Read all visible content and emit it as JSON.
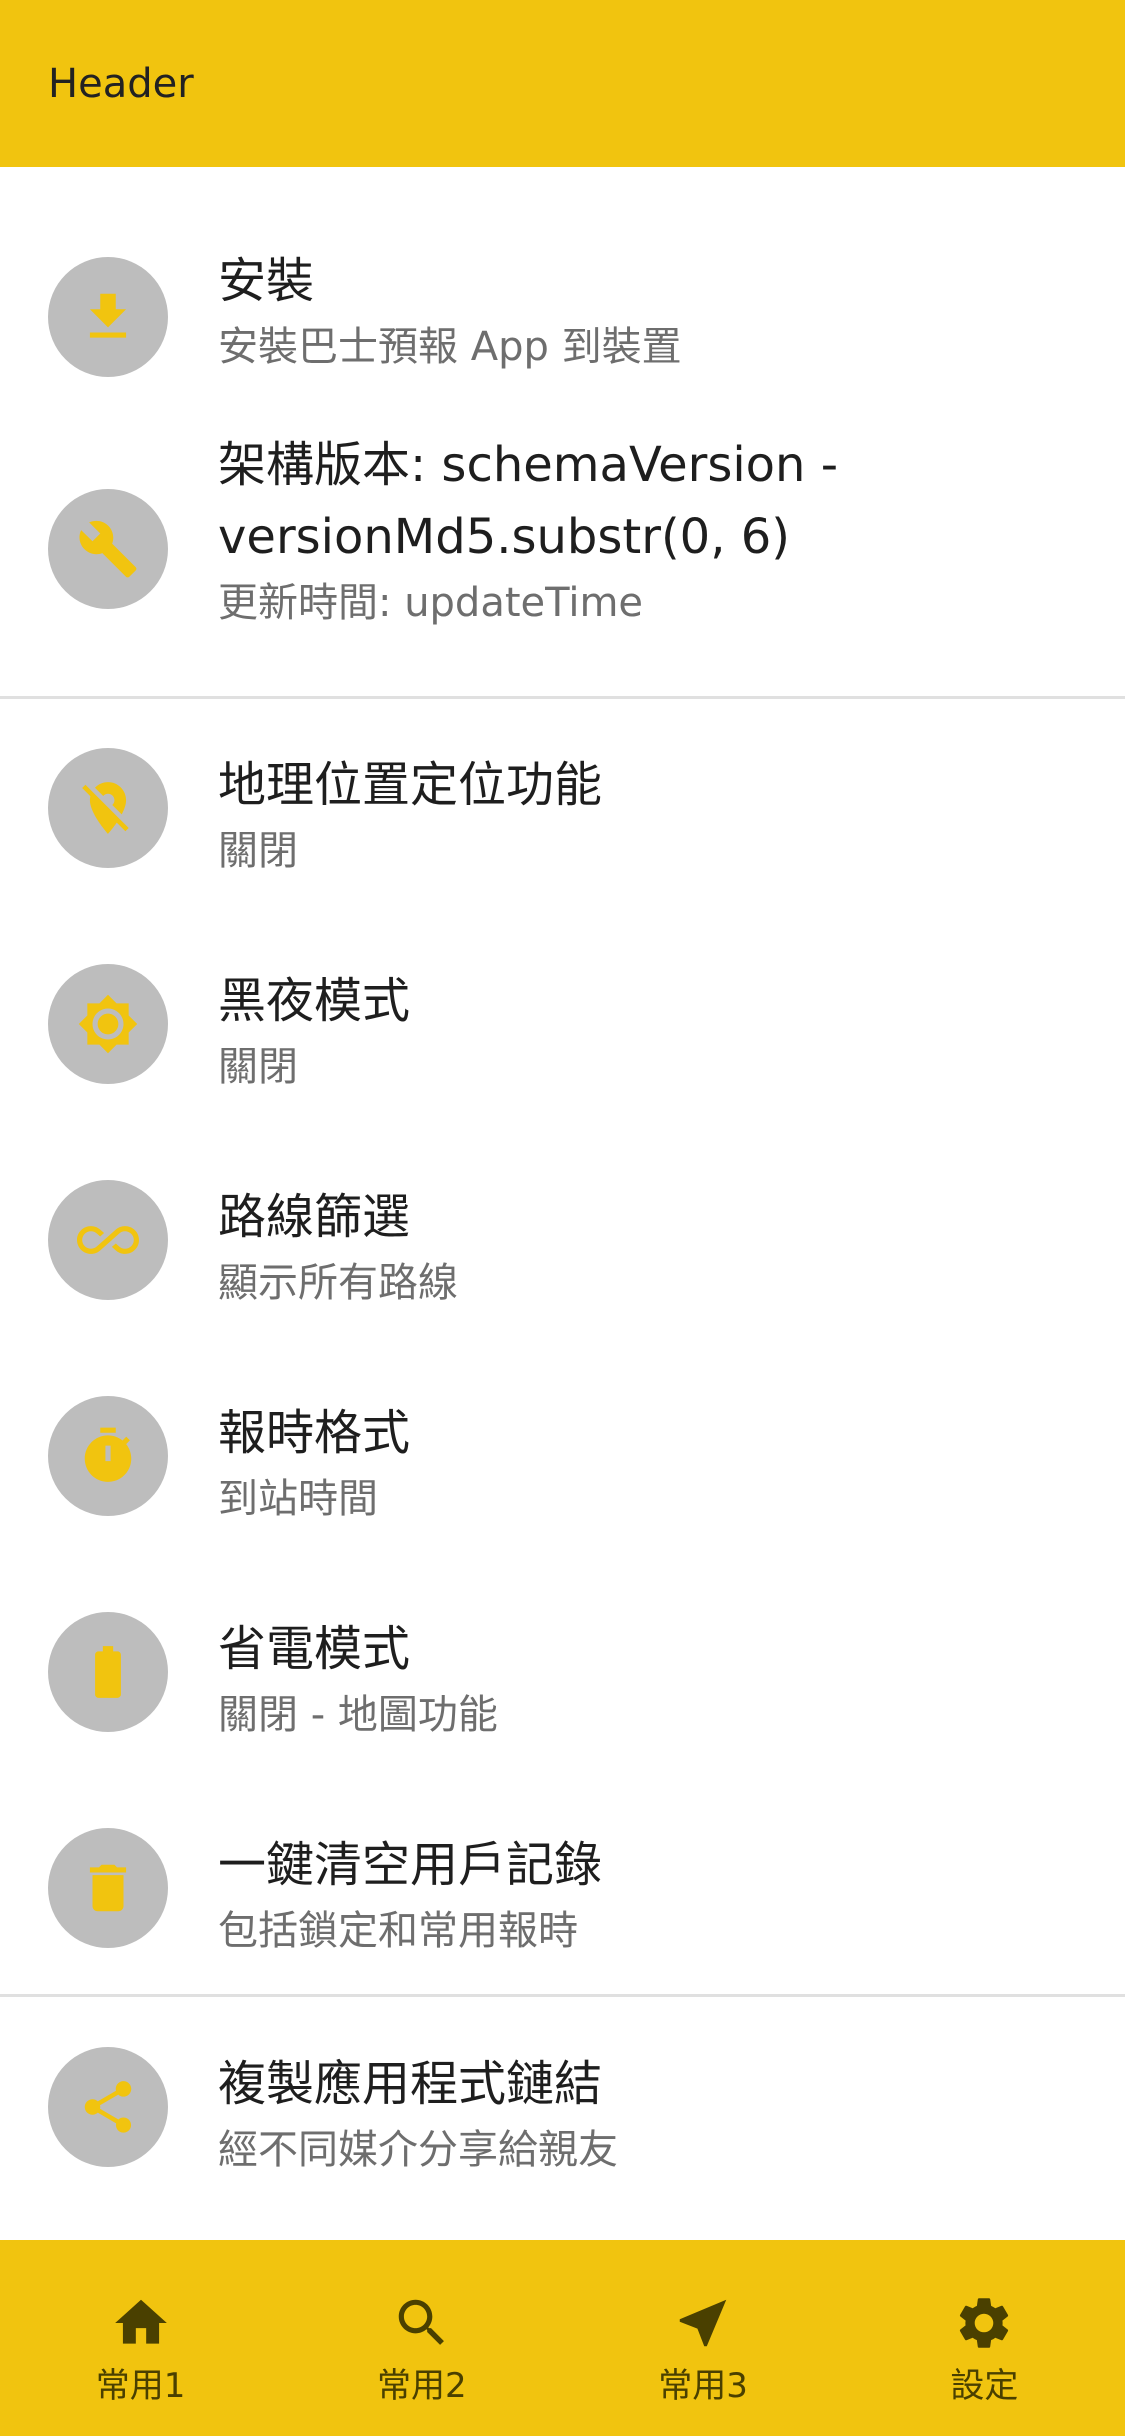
{
  "header": {
    "title": "Header"
  },
  "settings": [
    {
      "icon": "download-icon",
      "title": "安裝",
      "subtitle": "安裝巴士預報 App 到裝置"
    },
    {
      "icon": "wrench-icon",
      "title": "架構版本: schemaVersion - versionMd5.substr(0, 6)",
      "subtitle": "更新時間: updateTime"
    },
    {
      "icon": "location-off-icon",
      "title": "地理位置定位功能",
      "subtitle": "關閉"
    },
    {
      "icon": "brightness-icon",
      "title": "黑夜模式",
      "subtitle": "關閉"
    },
    {
      "icon": "infinity-icon",
      "title": "路線篩選",
      "subtitle": "顯示所有路線"
    },
    {
      "icon": "timer-icon",
      "title": "報時格式",
      "subtitle": "到站時間"
    },
    {
      "icon": "battery-icon",
      "title": "省電模式",
      "subtitle": "關閉 - 地圖功能"
    },
    {
      "icon": "trash-icon",
      "title": "一鍵清空用戶記錄",
      "subtitle": "包括鎖定和常用報時"
    },
    {
      "icon": "share-icon",
      "title": "複製應用程式鏈結",
      "subtitle": "經不同媒介分享給親友"
    }
  ],
  "bottom_nav": [
    {
      "icon": "home-icon",
      "label": "常用1"
    },
    {
      "icon": "search-icon",
      "label": "常用2"
    },
    {
      "icon": "navigation-icon",
      "label": "常用3"
    },
    {
      "icon": "gear-icon",
      "label": "設定"
    }
  ],
  "colors": {
    "accent": "#f1c40f",
    "icon_circle": "#bdbdbd",
    "nav_content": "#4a4000"
  }
}
